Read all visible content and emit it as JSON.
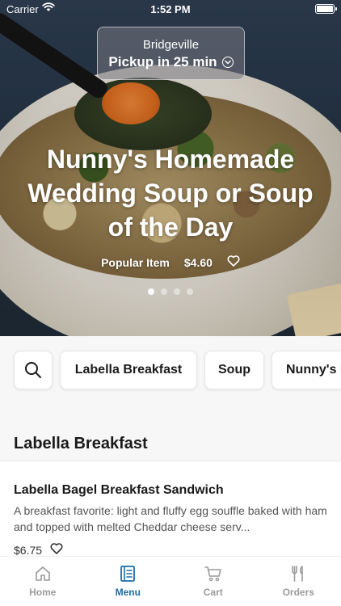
{
  "status_bar": {
    "carrier": "Carrier",
    "time": "1:52 PM"
  },
  "location": {
    "name": "Bridgeville",
    "pickup": "Pickup in 25 min"
  },
  "featured": {
    "title": "Nunny's Homemade Wedding Soup or Soup of the Day",
    "tag": "Popular Item",
    "price": "$4.60",
    "carousel": {
      "count": 4,
      "active_index": 0
    }
  },
  "categories": [
    "Labella Breakfast",
    "Soup",
    "Nunny's I"
  ],
  "section": {
    "title": "Labella Breakfast",
    "items": [
      {
        "name": "Labella Bagel Breakfast Sandwich",
        "description": "A breakfast favorite: light and fluffy egg souffle baked with ham and topped with melted Cheddar cheese serv...",
        "price": "$6.75"
      }
    ]
  },
  "tabs": [
    {
      "label": "Home",
      "icon": "home-icon"
    },
    {
      "label": "Menu",
      "icon": "menu-icon",
      "active": true
    },
    {
      "label": "Cart",
      "icon": "cart-icon"
    },
    {
      "label": "Orders",
      "icon": "fork-knife-icon"
    }
  ],
  "colors": {
    "accent": "#1d6ca8",
    "inactive": "#9a9a9a"
  }
}
